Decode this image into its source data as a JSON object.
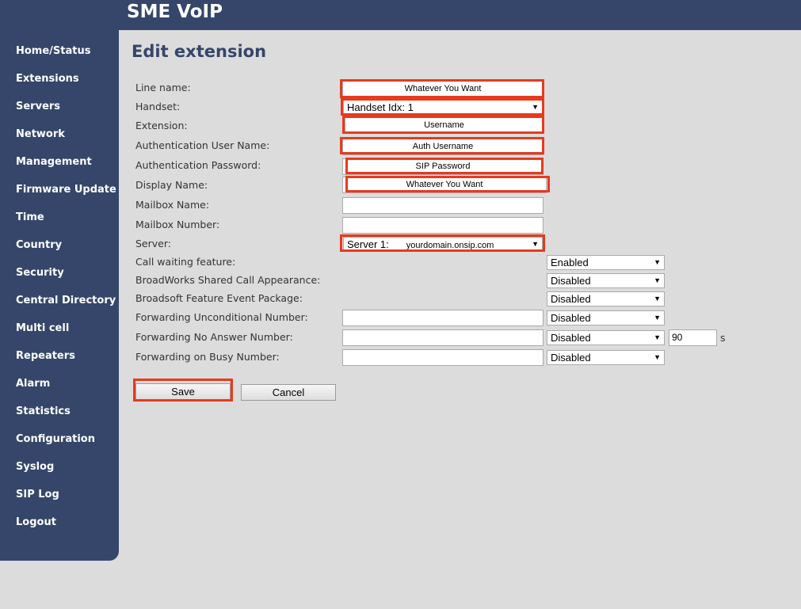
{
  "app": {
    "title": "SME VoIP"
  },
  "nav": {
    "items": [
      "Home/Status",
      "Extensions",
      "Servers",
      "Network",
      "Management",
      "Firmware Update",
      "Time",
      "Country",
      "Security",
      "Central Directory",
      "Multi cell",
      "Repeaters",
      "Alarm",
      "Statistics",
      "Configuration",
      "Syslog",
      "SIP Log",
      "Logout"
    ]
  },
  "page": {
    "title": "Edit extension"
  },
  "form": {
    "line_name": {
      "label": "Line name:",
      "value": "Whatever You Want"
    },
    "handset": {
      "label": "Handset:",
      "value": "Handset Idx: 1"
    },
    "extension": {
      "label": "Extension:",
      "value": "Username"
    },
    "auth_user": {
      "label": "Authentication User Name:",
      "value": "Auth Username"
    },
    "auth_password": {
      "label": "Authentication Password:",
      "value": "SIP Password"
    },
    "display_name": {
      "label": "Display Name:",
      "value": "Whatever You Want"
    },
    "mailbox_name": {
      "label": "Mailbox Name:",
      "value": ""
    },
    "mailbox_number": {
      "label": "Mailbox Number:",
      "value": ""
    },
    "server": {
      "label": "Server:",
      "value_prefix": "Server 1:",
      "value_domain": "yourdomain.onsip.com"
    },
    "call_waiting": {
      "label": "Call waiting feature:",
      "value": "Enabled"
    },
    "broadworks_sca": {
      "label": "BroadWorks Shared Call Appearance:",
      "value": "Disabled"
    },
    "broadsoft_event": {
      "label": "Broadsoft Feature Event Package:",
      "value": "Disabled"
    },
    "fwd_unconditional": {
      "label": "Forwarding Unconditional Number:",
      "number": "",
      "value": "Disabled"
    },
    "fwd_no_answer": {
      "label": "Forwarding No Answer Number:",
      "number": "",
      "value": "Disabled",
      "timeout": "90",
      "unit": "s"
    },
    "fwd_busy": {
      "label": "Forwarding on Busy Number:",
      "number": "",
      "value": "Disabled"
    }
  },
  "buttons": {
    "save": "Save",
    "cancel": "Cancel"
  },
  "colors": {
    "header_bg": "#35466a",
    "page_bg": "#dcdcdc",
    "highlight": "#e83a1e"
  }
}
